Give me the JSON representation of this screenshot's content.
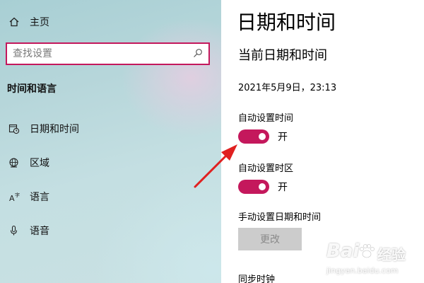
{
  "sidebar": {
    "home_label": "主页",
    "search": {
      "placeholder": "查找设置"
    },
    "section_title": "时间和语言",
    "items": [
      {
        "label": "日期和时间",
        "icon": "calendar-clock-icon"
      },
      {
        "label": "区域",
        "icon": "globe-icon"
      },
      {
        "label": "语言",
        "icon": "language-icon"
      },
      {
        "label": "语音",
        "icon": "microphone-icon"
      }
    ]
  },
  "main": {
    "title": "日期和时间",
    "subtitle": "当前日期和时间",
    "current_datetime": "2021年5月9日，23:13",
    "auto_time": {
      "label": "自动设置时间",
      "state": "开"
    },
    "auto_timezone": {
      "label": "自动设置时区",
      "state": "开"
    },
    "manual": {
      "label": "手动设置日期和时间",
      "button": "更改"
    },
    "sync": {
      "label": "同步时钟"
    }
  },
  "colors": {
    "accent": "#c4185c",
    "arrow": "#e02020"
  },
  "watermark": {
    "brand": "Bai",
    "brand_suffix": "经验",
    "url": "jingyan.baidu.com"
  }
}
